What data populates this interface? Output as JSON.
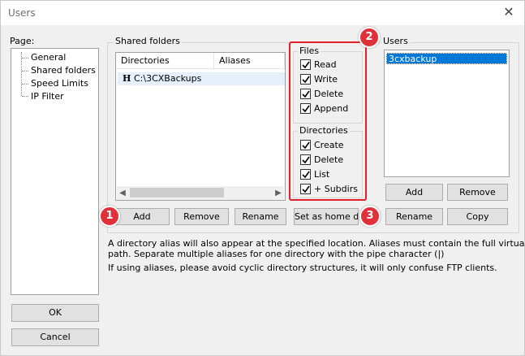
{
  "window": {
    "title": "Users"
  },
  "page_panel": {
    "label": "Page:",
    "items": [
      "General",
      "Shared folders",
      "Speed Limits",
      "IP Filter"
    ]
  },
  "shared_folders": {
    "group_title": "Shared folders",
    "columns": [
      "Directories",
      "Aliases"
    ],
    "rows": [
      {
        "marker": "H",
        "directory": "C:\\3CXBackups",
        "alias": ""
      }
    ],
    "buttons": {
      "add": "Add",
      "remove": "Remove",
      "rename": "Rename",
      "set_home": "Set as home dir"
    }
  },
  "files": {
    "group_title": "Files",
    "options": [
      {
        "label": "Read",
        "checked": true
      },
      {
        "label": "Write",
        "checked": true
      },
      {
        "label": "Delete",
        "checked": true
      },
      {
        "label": "Append",
        "checked": true
      }
    ]
  },
  "directories": {
    "group_title": "Directories",
    "options": [
      {
        "label": "Create",
        "checked": true
      },
      {
        "label": "Delete",
        "checked": true
      },
      {
        "label": "List",
        "checked": true
      },
      {
        "label": "+ Subdirs",
        "checked": true
      }
    ]
  },
  "users": {
    "group_title": "Users",
    "items": [
      "3cxbackup"
    ],
    "buttons": {
      "add": "Add",
      "remove": "Remove",
      "rename": "Rename",
      "copy": "Copy"
    }
  },
  "info": {
    "line1": "A directory alias will also appear at the specified location. Aliases must contain the full virtual",
    "line2": "path. Separate multiple aliases for one directory with the pipe character (|)",
    "line3": "If using aliases, please avoid cyclic directory structures, it will only confuse FTP clients."
  },
  "dialog_buttons": {
    "ok": "OK",
    "cancel": "Cancel"
  },
  "annotations": {
    "badge1": "1",
    "badge2": "2",
    "badge3": "3"
  },
  "colors": {
    "accent": "#0078d7",
    "annotation_red": "#e0202a",
    "selection_light": "#e6f0fa"
  }
}
